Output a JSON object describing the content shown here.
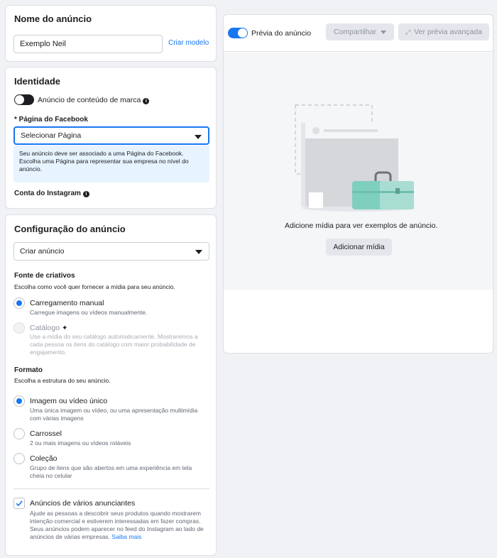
{
  "ad_name": {
    "title": "Nome do anúncio",
    "input_value": "Exemplo Neil",
    "template_link": "Criar modelo"
  },
  "identity": {
    "title": "Identidade",
    "branded_content_label": "Anúncio de conteúdo de marca",
    "facebook_page_label": "* Página do Facebook",
    "page_select_value": "Selecionar Página",
    "page_help_text": "Seu anúncio deve ser associado a uma Página do Facebook. Escolha uma Página para representar sua empresa no nível do anúncio.",
    "instagram_label": "Conta do Instagram"
  },
  "ad_setup": {
    "title": "Configuração do anúncio",
    "create_select_value": "Criar anúncio",
    "creative_source": {
      "title": "Fonte de criativos",
      "subtitle": "Escolha como você quer fornecer a mídia para seu anúncio.",
      "options": [
        {
          "label": "Carregamento manual",
          "desc": "Carregue imagens ou vídeos manualmente.",
          "selected": true
        },
        {
          "label": "Catálogo",
          "desc": "Use a mídia do seu catálogo automaticamente. Mostraremos a cada pessoa os itens do catálogo com maior probabilidade de engajamento.",
          "selected": false
        }
      ]
    },
    "format": {
      "title": "Formato",
      "subtitle": "Escolha a estrutura do seu anúncio.",
      "options": [
        {
          "label": "Imagem ou vídeo único",
          "desc": "Uma única imagem ou vídeo, ou uma apresentação multimídia com várias imagens",
          "selected": true
        },
        {
          "label": "Carrossel",
          "desc": "2 ou mais imagens ou vídeos roláveis",
          "selected": false
        },
        {
          "label": "Coleção",
          "desc": "Grupo de itens que são abertos em uma experiência em tela cheia no celular",
          "selected": false
        }
      ]
    },
    "multi_advertiser": {
      "label": "Anúncios de vários anunciantes",
      "desc": "Ajude as pessoas a descobrir seus produtos quando mostrarem intenção comercial e estiverem interessadas em fazer compras. Seus anúncios podem aparecer no feed do Instagram ao lado de anúncios de várias empresas.",
      "learn_more": "Saiba mais",
      "checked": true
    }
  },
  "preview": {
    "toggle_label": "Prévia do anúncio",
    "share_label": "Compartilhar",
    "advanced_label": "Ver prévia avançada",
    "empty_text": "Adicione mídia para ver exemplos de anúncio.",
    "add_media_label": "Adicionar mídia"
  },
  "colors": {
    "accent": "#1877f2",
    "toolbox": "#7fcfbf"
  }
}
